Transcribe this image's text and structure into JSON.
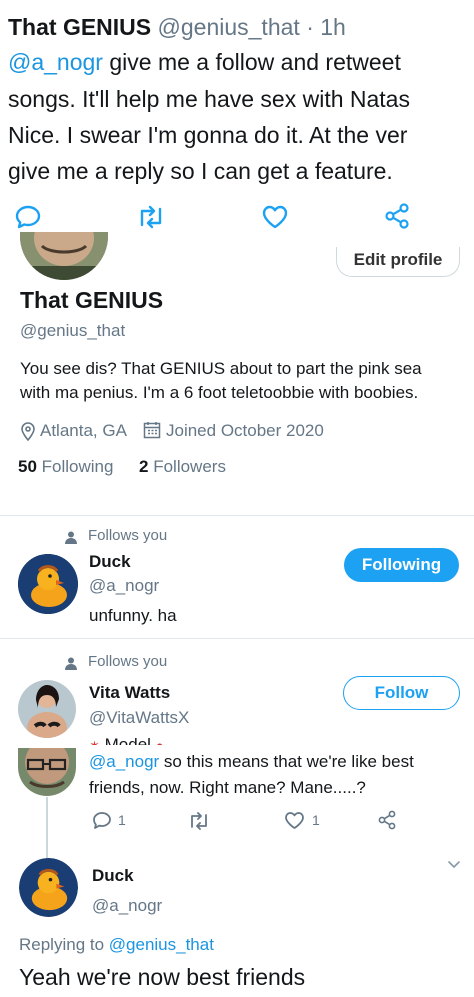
{
  "top_tweet": {
    "author_name": "That GENIUS",
    "handle": "@genius_that",
    "separator": "·",
    "time": "1h",
    "mention": "@a_nogr",
    "line1_rest": " give me a follow and retweet",
    "line2": "songs. It'll help me have sex with Natas",
    "line3": "Nice. I swear I'm gonna do it. At the ver",
    "line4": "give me a reply so I can get a feature."
  },
  "profile": {
    "edit_label": "Edit profile",
    "name": "That GENIUS",
    "handle": "@genius_that",
    "bio_line1": "You see dis? That GENIUS about to part the pink sea",
    "bio_line2": "with ma penius. I'm a 6 foot teletoobbie with boobies.",
    "location": "Atlanta, GA",
    "joined": "Joined October 2020",
    "following_count": "50",
    "following_label": "Following",
    "followers_count": "2",
    "followers_label": "Followers"
  },
  "follow_list": [
    {
      "follows_you": "Follows you",
      "name": "Duck",
      "handle": "@a_nogr",
      "bio": "unfunny. ha",
      "button": "Following"
    },
    {
      "follows_you": "Follows you",
      "name": "Vita Watts",
      "handle": "@VitaWattsX",
      "bio": "Model",
      "button": "Follow"
    }
  ],
  "reply_tweet": {
    "mention": "@a_nogr",
    "line1_rest": " so this means that we're like best",
    "line2": "friends, now. Right mane? Mane.....?",
    "reply_count": "1",
    "like_count": "1"
  },
  "duck_tweet": {
    "name": "Duck",
    "handle": "@a_nogr",
    "replying_prefix": "Replying to ",
    "replying_to": "@genius_that",
    "text": "Yeah we're now best friends"
  },
  "colors": {
    "accent": "#1da1f2",
    "text_gray": "#657786",
    "divider": "#e1e8ed"
  },
  "icons": {
    "reply": "reply-icon",
    "retweet": "retweet-icon",
    "like": "heart-icon",
    "share": "share-icon",
    "location": "location-pin-icon",
    "calendar": "calendar-icon",
    "person": "person-icon",
    "caret": "chevron-down-icon"
  }
}
